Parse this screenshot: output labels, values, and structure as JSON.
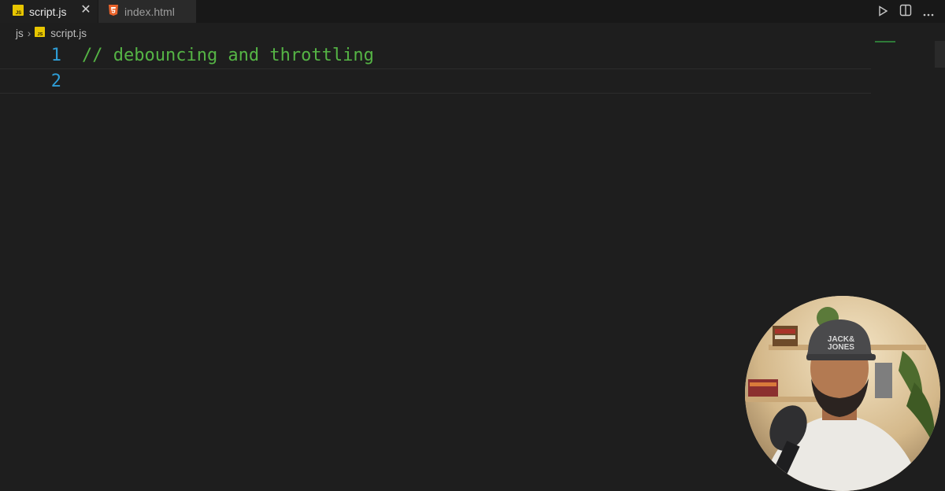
{
  "tabs": [
    {
      "label": "script.js",
      "active": true,
      "icon": "js-file-icon"
    },
    {
      "label": "index.html",
      "active": false,
      "icon": "html-file-icon"
    }
  ],
  "tab_close_glyph": "✕",
  "actions": [
    "run-icon",
    "split-editor-icon",
    "more-actions-icon"
  ],
  "breadcrumb": {
    "folder": "js",
    "separator": "›",
    "file": "script.js"
  },
  "editor": {
    "lines": [
      {
        "number": "1",
        "text": "// debouncing and throttling"
      },
      {
        "number": "2",
        "text": ""
      }
    ]
  },
  "colors": {
    "comment": "#55b445",
    "line_number": "#2e9dd6",
    "editor_bg": "#1e1e1e",
    "js_icon": "#e8c600",
    "html_icon": "#e8622a"
  }
}
